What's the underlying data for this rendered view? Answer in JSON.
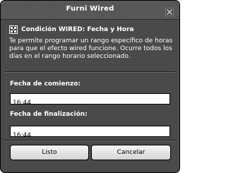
{
  "window": {
    "title": "Furni Wired"
  },
  "header": {
    "title": "Condición WIRED: Fecha y Hora",
    "description": "Te permite programar un rango específico de horas para que el efecto wired funcione. Ocurre todos los días en el rango horario seleccionado."
  },
  "start": {
    "label": "Fecha de comienzo:",
    "value": "16:44"
  },
  "end": {
    "label": "Fecha de finalización:",
    "value": "16:44"
  },
  "buttons": {
    "ok_label": "Listo",
    "cancel_label": "Cancelar"
  },
  "icons": {
    "close": "close-icon",
    "wired": "wired-condition-icon"
  }
}
